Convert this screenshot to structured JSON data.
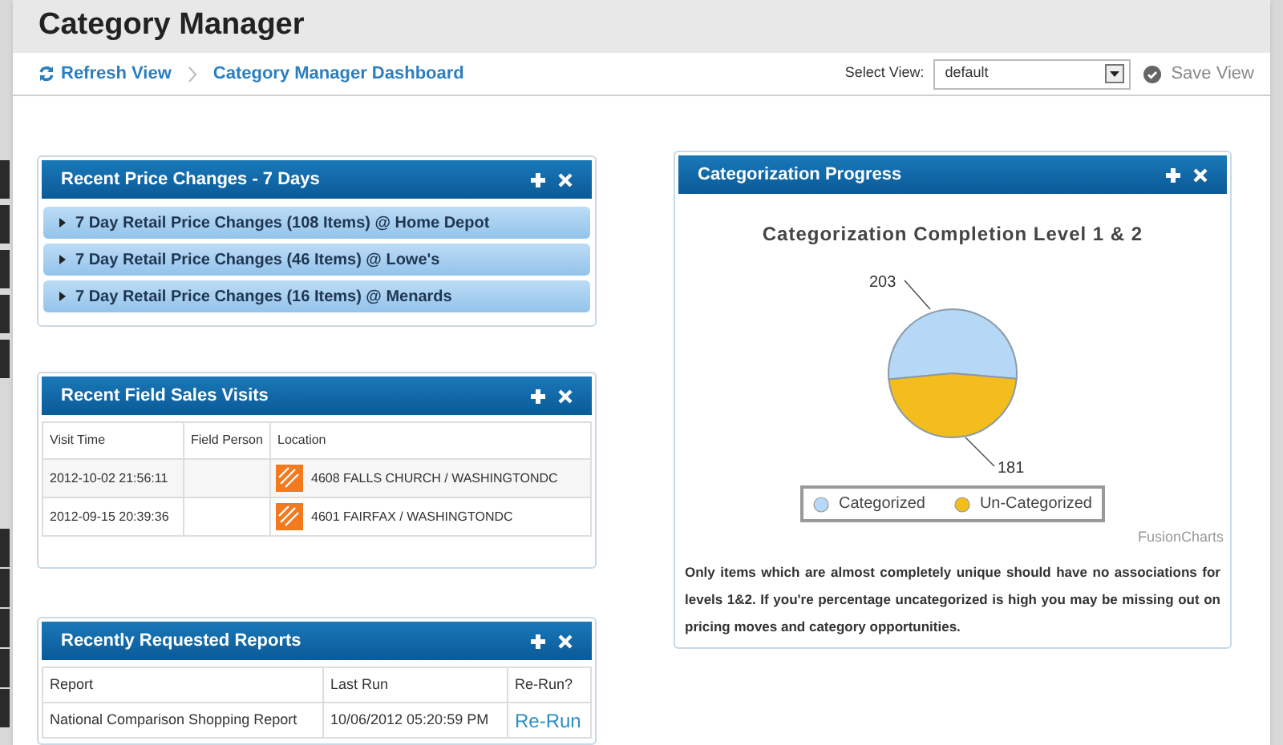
{
  "header": {
    "title": "Category Manager"
  },
  "toolbar": {
    "refresh": "Refresh View",
    "breadcrumb": "Category Manager Dashboard",
    "select_label": "Select View:",
    "select_value": "default",
    "save": "Save View"
  },
  "price_panel": {
    "title": "Recent Price Changes - 7 Days",
    "rows": [
      {
        "label": "7 Day Retail Price Changes (108 Items) @ Home Depot",
        "expanded": false
      },
      {
        "label": "7 Day Retail Price Changes (46 Items) @ Lowe's",
        "expanded": false
      },
      {
        "label": "7 Day Retail Price Changes (16 Items) @ Menards",
        "expanded": false
      }
    ]
  },
  "visits_panel": {
    "title": "Recent Field Sales Visits",
    "columns": [
      "Visit Time",
      "Field Person",
      "Location"
    ],
    "rows": [
      {
        "time": "2012-10-02 21:56:11",
        "location": "4608 FALLS CHURCH / WASHINGTONDC"
      },
      {
        "time": "2012-09-15 20:39:36",
        "location": "4601 FAIRFAX / WASHINGTONDC"
      }
    ]
  },
  "reports_panel": {
    "title": "Recently Requested Reports",
    "columns": [
      "Report",
      "Last Run",
      "Re-Run?"
    ],
    "rows": [
      {
        "report": "National Comparison Shopping Report",
        "last_run": "10/06/2012 05:20:59 PM",
        "action": "Re-Run"
      }
    ]
  },
  "progress_panel": {
    "title": "Categorization Progress",
    "chart_data": {
      "type": "pie",
      "title": "Categorization Completion Level 1 & 2",
      "categories": [
        "Categorized",
        "Un-Categorized"
      ],
      "values": [
        203,
        181
      ],
      "colors": [
        "#b4d8f6",
        "#f2bd1d"
      ],
      "data_labels": true
    },
    "credit": "FusionCharts",
    "note": "Only items which are almost completely unique should have no associations for levels 1&2. If you're percentage uncategorized is high you may be missing out on pricing moves and category opportunities."
  }
}
